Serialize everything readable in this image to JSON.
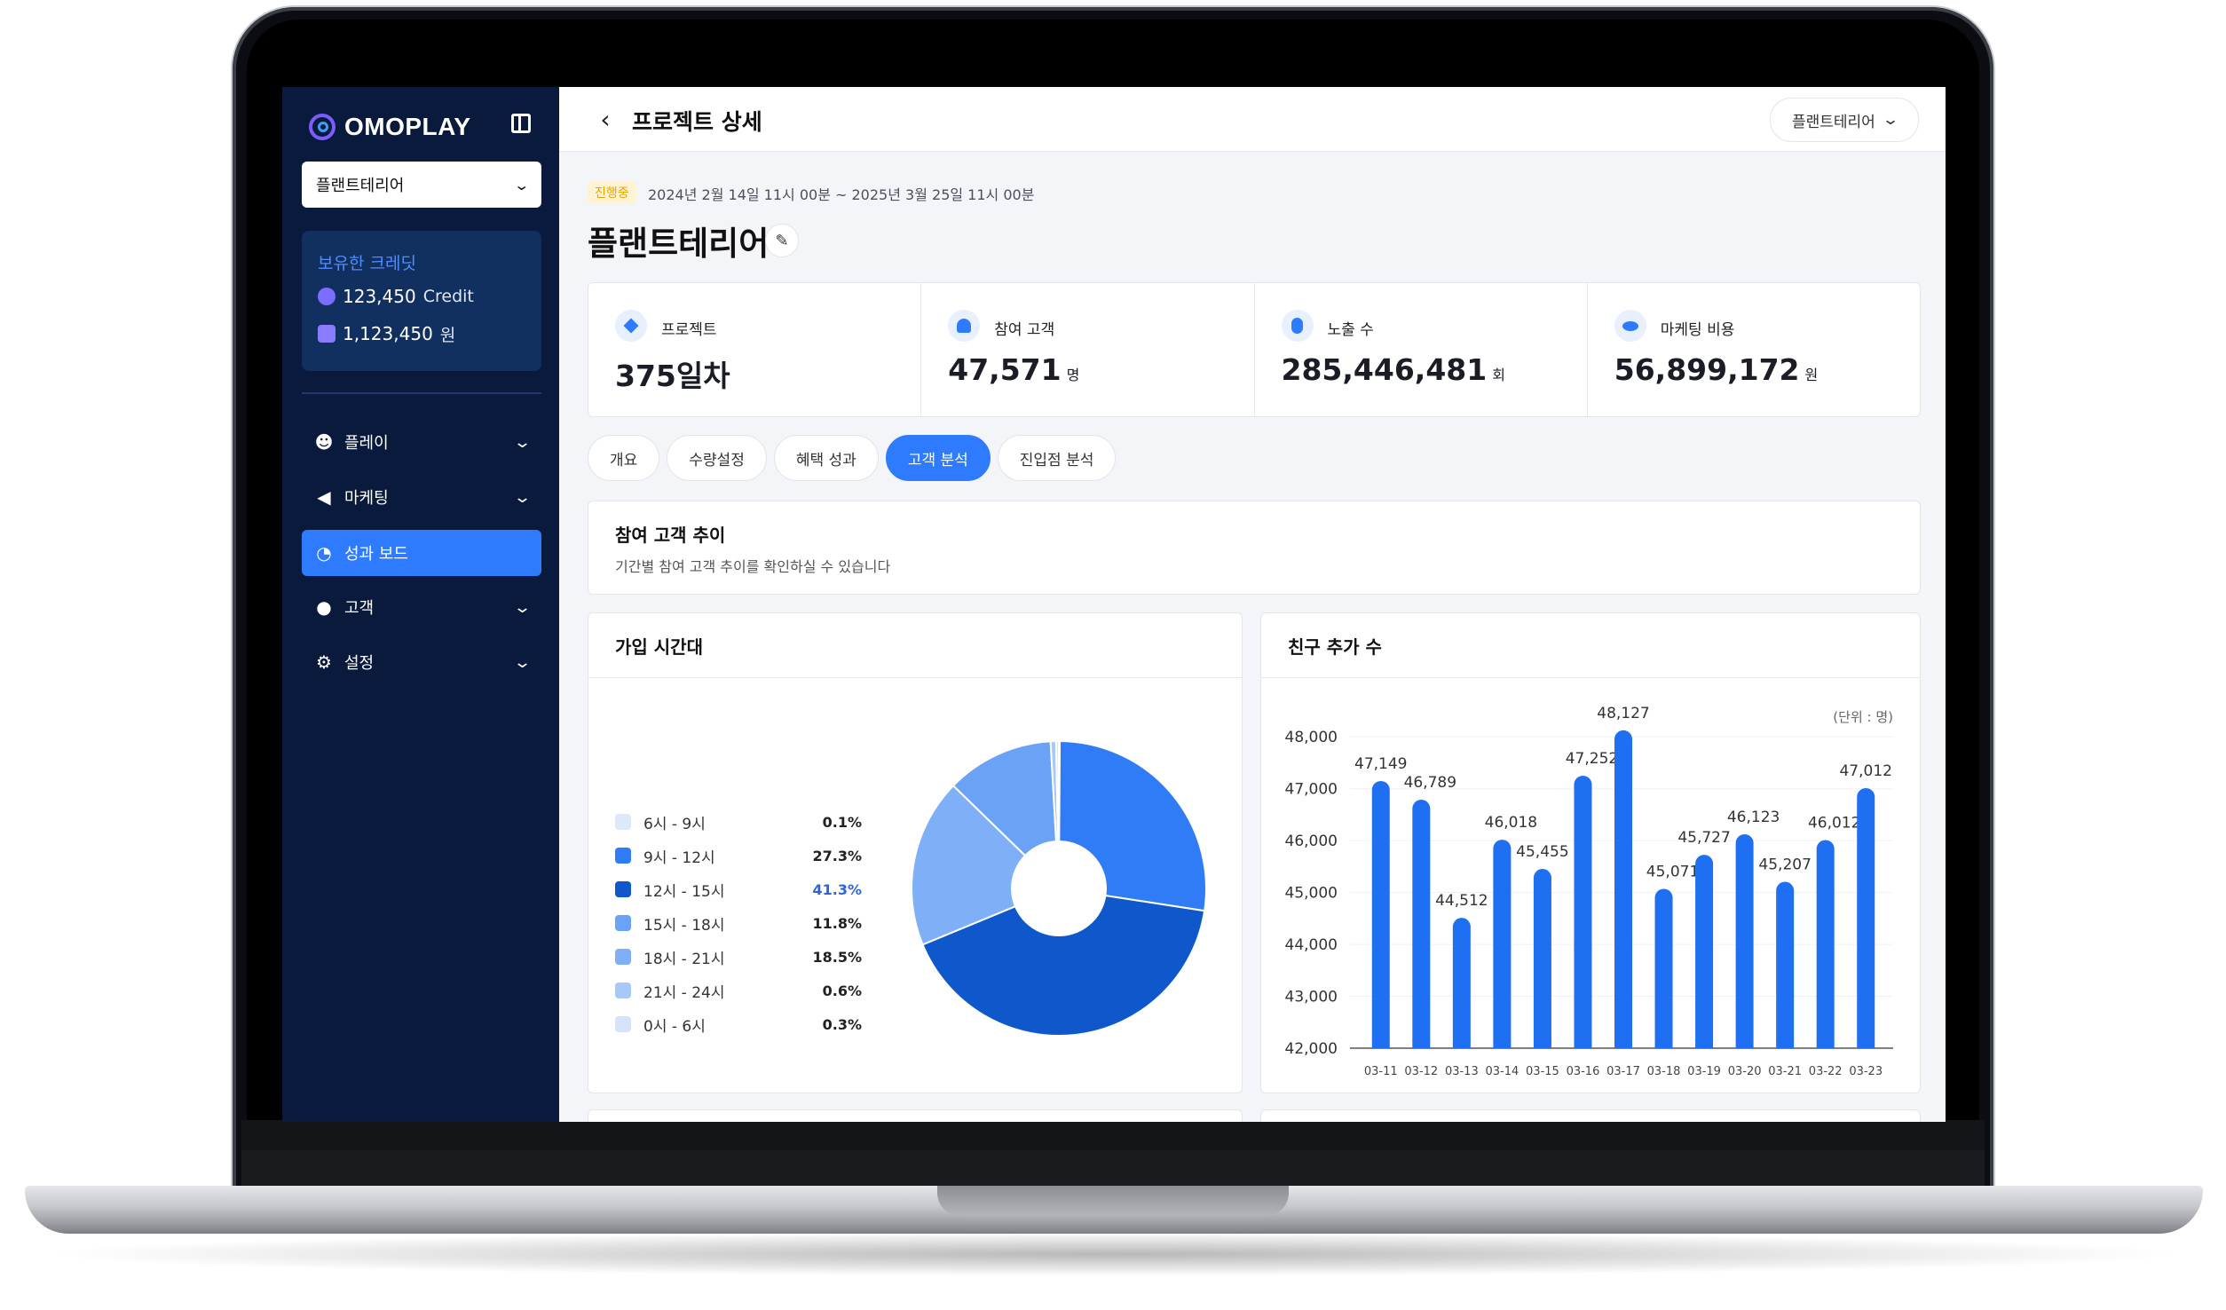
{
  "app": {
    "brand": "OMOPLAY"
  },
  "sidebar": {
    "project_select": "플랜트테리어",
    "credit": {
      "title": "보유한 크레딧",
      "credit_value": "123,450",
      "credit_unit": "Credit",
      "won_value": "1,123,450",
      "won_unit": "원"
    },
    "items": [
      {
        "label": "플레이",
        "icon": "gamepad-icon",
        "expandable": true
      },
      {
        "label": "마케팅",
        "icon": "megaphone-icon",
        "expandable": true
      },
      {
        "label": "성과 보드",
        "icon": "pie-chart-icon",
        "active": true
      },
      {
        "label": "고객",
        "icon": "user-icon",
        "expandable": true
      },
      {
        "label": "설정",
        "icon": "gear-icon",
        "expandable": true
      }
    ]
  },
  "header": {
    "title": "프로젝트 상세",
    "select_value": "플랜트테리어"
  },
  "project": {
    "status": "진행중",
    "period": "2024년 2월 14일 11시 00분  ~  2025년 3월 25일 11시 00분",
    "name": "플랜트테리어"
  },
  "stats": [
    {
      "label": "프로젝트",
      "value": "375일차",
      "unit": "",
      "icon": "diamond-icon"
    },
    {
      "label": "참여 고객",
      "value": "47,571",
      "unit": "명",
      "icon": "user-icon"
    },
    {
      "label": "노출 수",
      "value": "285,446,481",
      "unit": "회",
      "icon": "mouse-icon"
    },
    {
      "label": "마케팅 비용",
      "value": "56,899,172",
      "unit": "원",
      "icon": "coins-icon"
    }
  ],
  "tabs": [
    "개요",
    "수량설정",
    "혜택 성과",
    "고객 분석",
    "진입점 분석"
  ],
  "active_tab": "고객 분석",
  "section": {
    "title": "참여 고객 추이",
    "desc": "기간별 참여 고객 추이를 확인하실 수 있습니다"
  },
  "colors": {
    "accent": "#2e7bff",
    "sidebar": "#0a1a3d"
  },
  "chart_data": [
    {
      "type": "pie",
      "title": "가입 시간대",
      "categories": [
        "6시 - 9시",
        "9시 - 12시",
        "12시 - 15시",
        "15시 - 18시",
        "18시 - 21시",
        "21시 - 24시",
        "0시 - 6시"
      ],
      "values": [
        0.1,
        27.3,
        41.3,
        11.8,
        18.5,
        0.6,
        0.3
      ],
      "labels": [
        "0.1%",
        "27.3%",
        "41.3%",
        "11.8%",
        "18.5%",
        "0.6%",
        "0.3%"
      ],
      "colors": [
        "#dce9fb",
        "#2f7cf6",
        "#0e58cc",
        "#6aa2f5",
        "#7fb0f7",
        "#a8c8fa",
        "#d4e4fb"
      ],
      "highlight_index": 2,
      "donut": true
    },
    {
      "type": "bar",
      "title": "친구 추가 수",
      "unit_note": "(단위 : 명)",
      "categories": [
        "03-11",
        "03-12",
        "03-13",
        "03-14",
        "03-15",
        "03-16",
        "03-17",
        "03-18",
        "03-19",
        "03-20",
        "03-21",
        "03-22",
        "03-23"
      ],
      "values": [
        47149,
        46789,
        44512,
        46018,
        45455,
        47252,
        48127,
        45071,
        45727,
        46123,
        45207,
        46012,
        47012
      ],
      "labels": [
        "47,149",
        "46,789",
        "44,512",
        "46,018",
        "45,455",
        "47,252",
        "48,127",
        "45,071",
        "45,727",
        "46,123",
        "45,207",
        "46,012",
        "47,012"
      ],
      "ylim": [
        42000,
        48500
      ],
      "yticks": [
        42000,
        43000,
        44000,
        45000,
        46000,
        47000,
        48000
      ],
      "ytick_labels": [
        "42,000",
        "43,000",
        "44,000",
        "45,000",
        "46,000",
        "47,000",
        "48,000"
      ],
      "color": "#1f6ff2",
      "grid": true
    }
  ]
}
